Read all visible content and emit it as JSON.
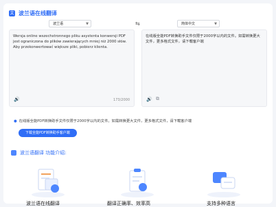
{
  "header": {
    "title": "波兰语在线翻译"
  },
  "translator": {
    "source_lang": "波兰语",
    "target_lang": "简体中文",
    "source_text": "Wersja online wszechstronnego pliku asystenta konwersji PDF jest ograniczona do plików zawierających mniej niż 2000 słów. Aby przekonwertować większe pliki, pobierz klienta.",
    "target_text": "在线版全能PDF转换助手文件仅限于2000字以内的文件。如需转换更大文件，更多格式文件，请下载客户端",
    "char_count": "173/2000"
  },
  "notice": {
    "text": "在线版全能PDF转换助手文件仅限于2000字以内的文件。如需转换更大文件，更多格式文件，请下载客户端",
    "download_button": "下载全能PDF转换助手客户端"
  },
  "intro": {
    "title": "波兰语翻译  功能介绍:",
    "features": [
      {
        "label": "波兰语在线翻译"
      },
      {
        "label": "翻译正确率、效率高"
      },
      {
        "label": "支持多种语言"
      }
    ]
  },
  "colors": {
    "accent": "#2f6df6",
    "panel_bg": "#f6f7f9",
    "page_bg": "#f3f5f9"
  },
  "icons": [
    "translate-icon",
    "chevron-down-icon",
    "swap-icon",
    "speaker-icon",
    "copy-icon",
    "feature-icon"
  ]
}
